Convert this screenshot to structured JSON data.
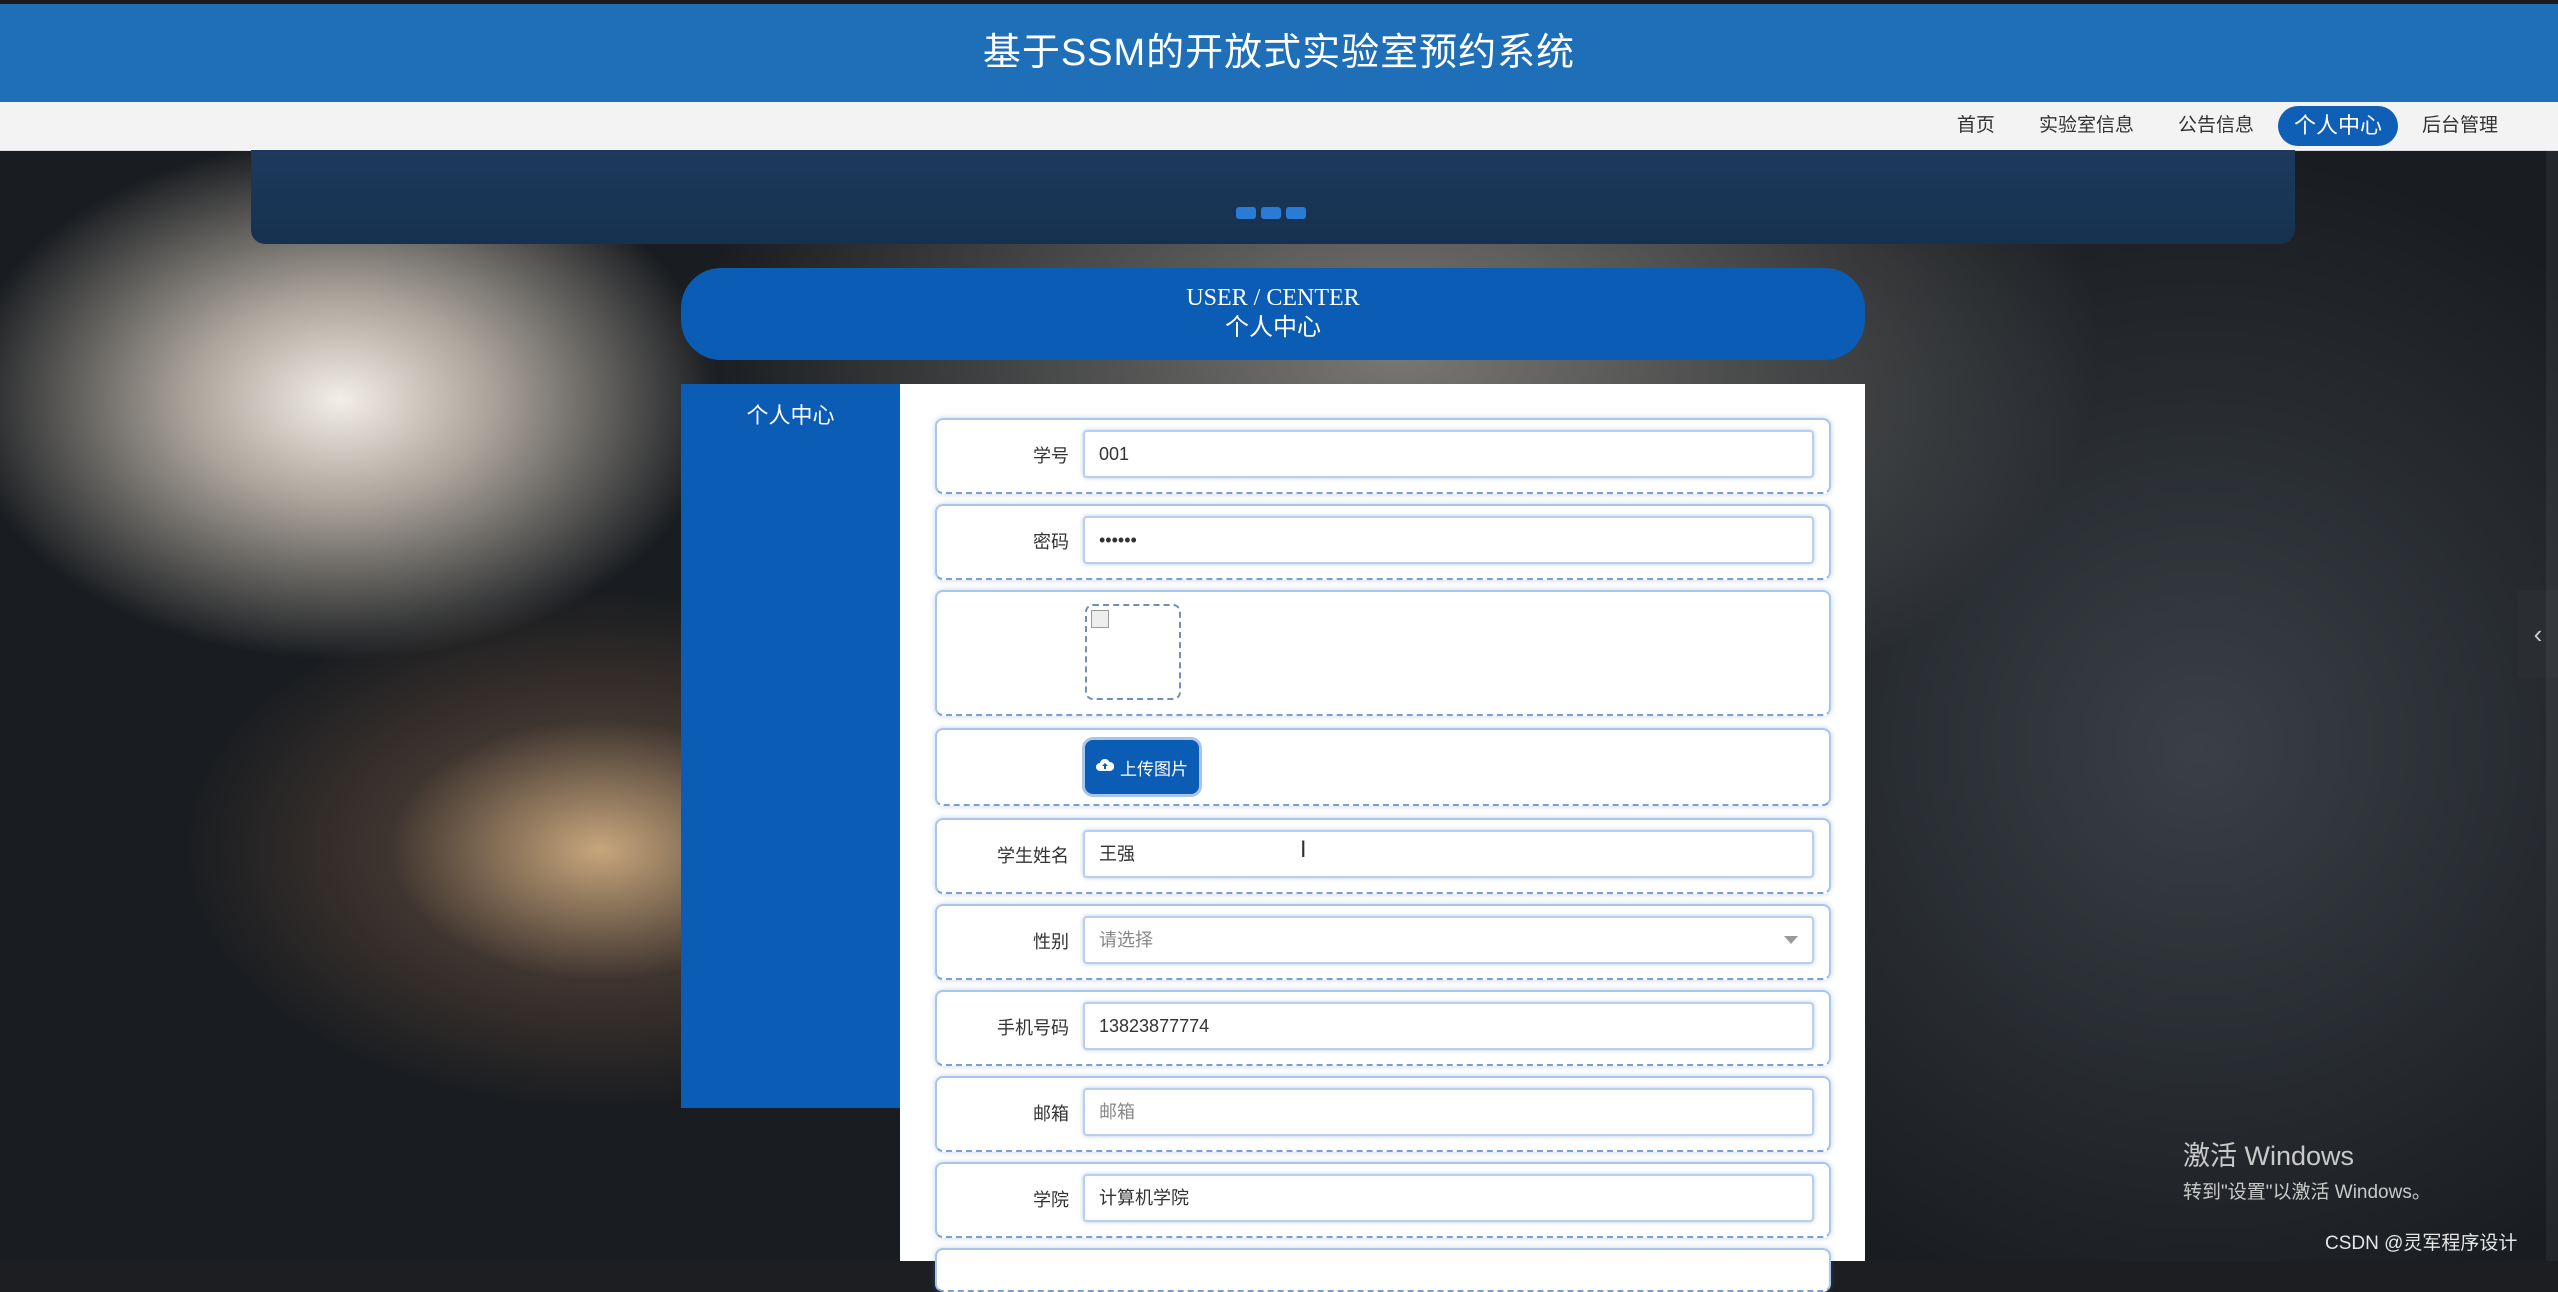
{
  "header": {
    "title": "基于SSM的开放式实验室预约系统"
  },
  "nav": {
    "items": [
      {
        "label": "首页",
        "active": false
      },
      {
        "label": "实验室信息",
        "active": false
      },
      {
        "label": "公告信息",
        "active": false
      },
      {
        "label": "个人中心",
        "active": true
      },
      {
        "label": "后台管理",
        "active": false
      }
    ]
  },
  "section": {
    "title_en": "USER / CENTER",
    "title_cn": "个人中心"
  },
  "sidebar": {
    "items": [
      {
        "label": "个人中心"
      }
    ]
  },
  "form": {
    "student_id": {
      "label": "学号",
      "value": "001"
    },
    "password": {
      "label": "密码",
      "value": "••••••"
    },
    "upload_button": "上传图片",
    "student_name": {
      "label": "学生姓名",
      "value": "王强"
    },
    "gender": {
      "label": "性别",
      "placeholder": "请选择"
    },
    "phone": {
      "label": "手机号码",
      "value": "13823877774"
    },
    "email": {
      "label": "邮箱",
      "placeholder": "邮箱"
    },
    "college": {
      "label": "学院",
      "value": "计算机学院"
    }
  },
  "watermark": {
    "line1": "激活 Windows",
    "line2": "转到\"设置\"以激活 Windows。"
  },
  "credit": "CSDN @灵军程序设计",
  "colors": {
    "primary": "#0a5cb5",
    "header": "#1f6fb8"
  }
}
